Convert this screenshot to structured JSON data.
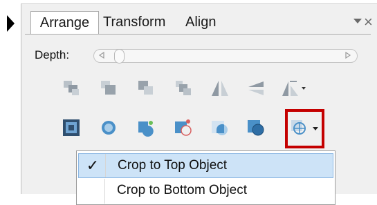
{
  "tabs": [
    {
      "label": "Arrange",
      "active": true
    },
    {
      "label": "Transform",
      "active": false
    },
    {
      "label": "Align",
      "active": false
    }
  ],
  "panel": {
    "menu_icon": "chevron-down-icon",
    "close_label": "×"
  },
  "depth": {
    "label": "Depth:"
  },
  "toolbar_row1": [
    "bring-forward-icon",
    "bring-to-front-icon",
    "send-backward-icon",
    "send-to-back-icon",
    "flip-horizontal-icon",
    "flip-vertical-icon",
    "rotate-dropdown-icon"
  ],
  "toolbar_row2": [
    "convert-to-shape-icon",
    "circle-shape-icon",
    "combine-shapes-icon",
    "subtract-shapes-icon",
    "intersect-shapes-icon",
    "fragment-shapes-icon",
    "crop-dropdown-icon"
  ],
  "dropdown_menu": {
    "items": [
      {
        "label": "Crop to Top Object",
        "checked": true,
        "check_glyph": "✓"
      },
      {
        "label": "Crop to Bottom Object",
        "checked": false,
        "check_glyph": ""
      }
    ]
  },
  "colors": {
    "highlight": "#c40000",
    "menu_hover": "#cde3f7",
    "icon_blue": "#4a90c8",
    "icon_gray": "#9aa3ab"
  }
}
